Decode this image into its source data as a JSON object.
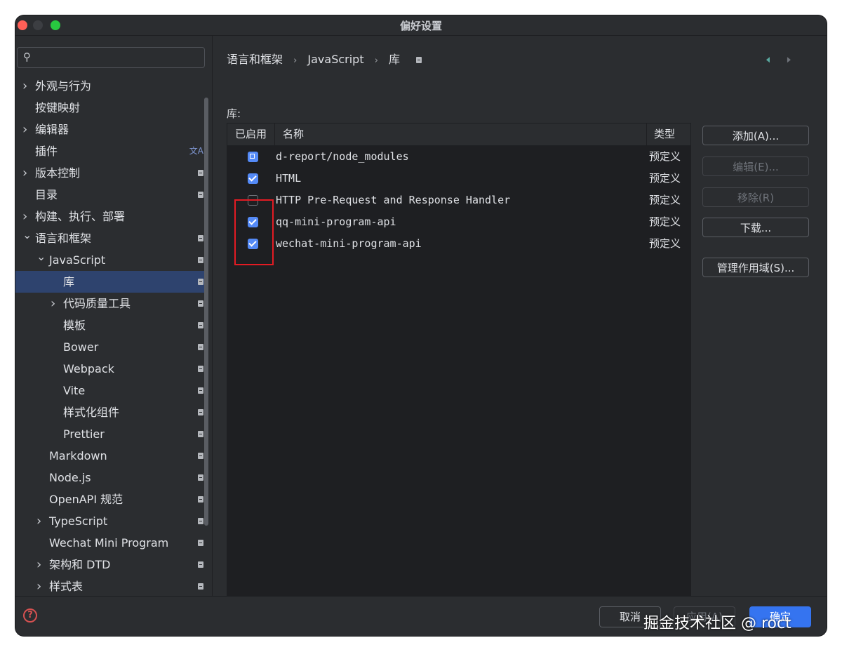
{
  "window": {
    "title": "偏好设置"
  },
  "search": {
    "placeholder": ""
  },
  "sidebar": {
    "items": [
      {
        "label": "外观与行为",
        "expandable": true,
        "expanded": false,
        "indent": 0,
        "mark": false
      },
      {
        "label": "按键映射",
        "expandable": false,
        "indent": 0,
        "mark": false
      },
      {
        "label": "编辑器",
        "expandable": true,
        "expanded": false,
        "indent": 0,
        "mark": false
      },
      {
        "label": "插件",
        "expandable": false,
        "indent": 0,
        "mark": false,
        "translate_icon": "translate-icon"
      },
      {
        "label": "版本控制",
        "expandable": true,
        "expanded": false,
        "indent": 0,
        "mark": true
      },
      {
        "label": "目录",
        "expandable": false,
        "indent": 0,
        "mark": true
      },
      {
        "label": "构建、执行、部署",
        "expandable": true,
        "expanded": false,
        "indent": 0,
        "mark": false
      },
      {
        "label": "语言和框架",
        "expandable": true,
        "expanded": true,
        "indent": 0,
        "mark": true
      },
      {
        "label": "JavaScript",
        "expandable": true,
        "expanded": true,
        "indent": 1,
        "mark": true
      },
      {
        "label": "库",
        "expandable": false,
        "indent": 2,
        "mark": true,
        "selected": true
      },
      {
        "label": "代码质量工具",
        "expandable": true,
        "expanded": false,
        "indent": 2,
        "mark": true
      },
      {
        "label": "模板",
        "expandable": false,
        "indent": 2,
        "mark": true
      },
      {
        "label": "Bower",
        "expandable": false,
        "indent": 2,
        "mark": true
      },
      {
        "label": "Webpack",
        "expandable": false,
        "indent": 2,
        "mark": true
      },
      {
        "label": "Vite",
        "expandable": false,
        "indent": 2,
        "mark": true
      },
      {
        "label": "样式化组件",
        "expandable": false,
        "indent": 2,
        "mark": true
      },
      {
        "label": "Prettier",
        "expandable": false,
        "indent": 2,
        "mark": true
      },
      {
        "label": "Markdown",
        "expandable": false,
        "indent": 1,
        "mark": true
      },
      {
        "label": "Node.js",
        "expandable": false,
        "indent": 1,
        "mark": true
      },
      {
        "label": "OpenAPI 规范",
        "expandable": false,
        "indent": 1,
        "mark": true
      },
      {
        "label": "TypeScript",
        "expandable": true,
        "expanded": false,
        "indent": 1,
        "mark": true
      },
      {
        "label": "Wechat Mini Program",
        "expandable": false,
        "indent": 1,
        "mark": true
      },
      {
        "label": "架构和 DTD",
        "expandable": true,
        "expanded": false,
        "indent": 1,
        "mark": true
      },
      {
        "label": "样式表",
        "expandable": true,
        "expanded": false,
        "indent": 1,
        "mark": true
      }
    ]
  },
  "breadcrumb": {
    "items": [
      "语言和框架",
      "JavaScript",
      "库"
    ]
  },
  "main": {
    "section_label": "库:",
    "table": {
      "headers": {
        "enabled": "已启用",
        "name": "名称",
        "type": "类型"
      },
      "rows": [
        {
          "state": "partial",
          "name": "d-report/node_modules",
          "type": "预定义"
        },
        {
          "state": "checked",
          "name": "HTML",
          "type": "预定义"
        },
        {
          "state": "unchecked",
          "name": "HTTP Pre-Request and Response Handler",
          "type": "预定义"
        },
        {
          "state": "checked",
          "name": "qq-mini-program-api",
          "type": "预定义"
        },
        {
          "state": "checked",
          "name": "wechat-mini-program-api",
          "type": "预定义"
        }
      ]
    },
    "buttons": {
      "add": "添加(A)...",
      "edit": "编辑(E)...",
      "remove": "移除(R)",
      "download": "下载...",
      "manage_scope": "管理作用域(S)..."
    }
  },
  "footer": {
    "cancel": "取消",
    "apply": "应用(A)",
    "ok": "确定"
  },
  "watermark": "掘金技术社区 @ roct",
  "colors": {
    "background": "#2b2d30",
    "table_bg": "#1e1f22",
    "selection": "#2e436e",
    "accent": "#3574f0",
    "checkbox": "#548af7",
    "highlight_box": "#e31b23"
  }
}
